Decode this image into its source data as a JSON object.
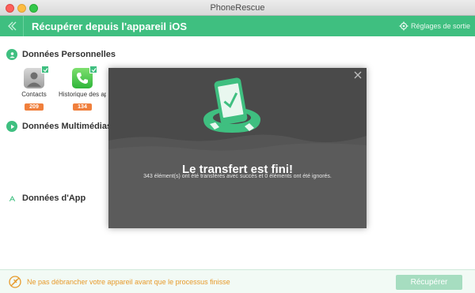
{
  "window": {
    "title": "PhoneRescue"
  },
  "header": {
    "title": "Récupérer depuis l'appareil iOS",
    "settings_label": "Réglages de sortie",
    "accent_color": "#3fbf80"
  },
  "sections": {
    "personal": {
      "label": "Données Personnelles",
      "icon": "user-icon"
    },
    "media": {
      "label": "Données Multimédias",
      "icon": "play-icon"
    },
    "apps": {
      "label": "Données d'App",
      "icon": "app-icon"
    }
  },
  "tiles": [
    {
      "name": "Contacts",
      "count": "209",
      "icon": "contacts-icon",
      "checked": true
    },
    {
      "name": "Historique des ap",
      "count": "134",
      "icon": "phone-icon",
      "checked": true
    }
  ],
  "modal": {
    "title": "Le transfert est fini!",
    "message": "343 élément(s) ont été transférés avec succès et 0 éléments ont été ignorés."
  },
  "bottom": {
    "warning": "Ne pas débrancher votre appareil avant que le processus finisse",
    "recover_label": "Récupérer",
    "warning_color": "#e79a2b"
  }
}
